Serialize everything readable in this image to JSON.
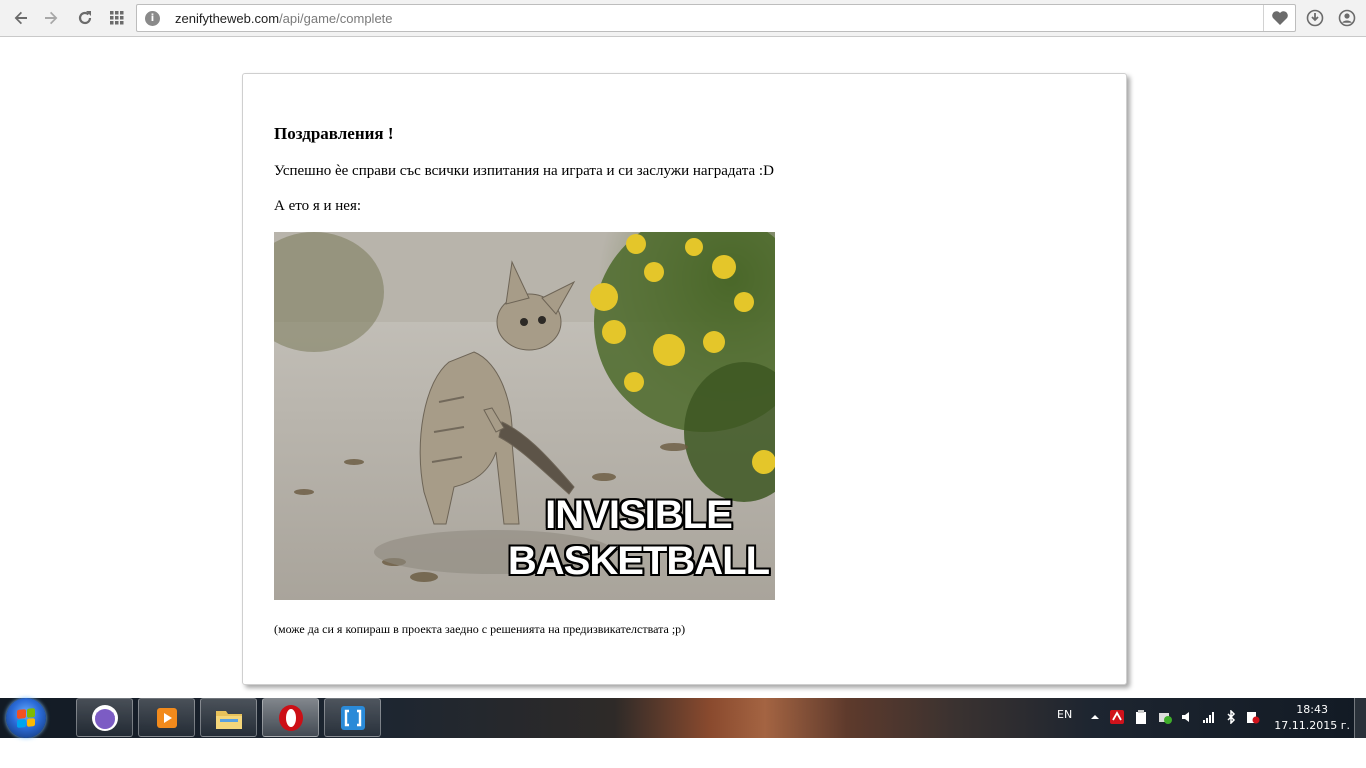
{
  "browser": {
    "url_host": "zenifytheweb.com",
    "url_path": "/api/game/complete",
    "icons": {
      "back": "arrow-left-icon",
      "forward": "arrow-right-icon",
      "reload": "reload-icon",
      "apps": "grid-icon",
      "site": "page-info-icon",
      "bookmark": "heart-icon",
      "downloads": "download-icon",
      "account": "account-icon"
    }
  },
  "page": {
    "title": "Поздравления !",
    "line1": "Успешно ѐе справи със всички изпитания на играта и си заслужи наградата :D",
    "line2": "А ето я и нея:",
    "meme_caption_line1": "INVISIBLE",
    "meme_caption_line2": "BASKETBALL",
    "footnote": "(може да си я копираш в проекта заедно с решенията на предизвикателствата ;p)"
  },
  "taskbar": {
    "apps": [
      "cat-app-icon",
      "media-player-icon",
      "file-explorer-icon",
      "opera-icon",
      "code-editor-icon"
    ],
    "language": "EN",
    "time": "18:43",
    "date": "17.11.2015 г.",
    "accent": "#2a6ad6"
  }
}
